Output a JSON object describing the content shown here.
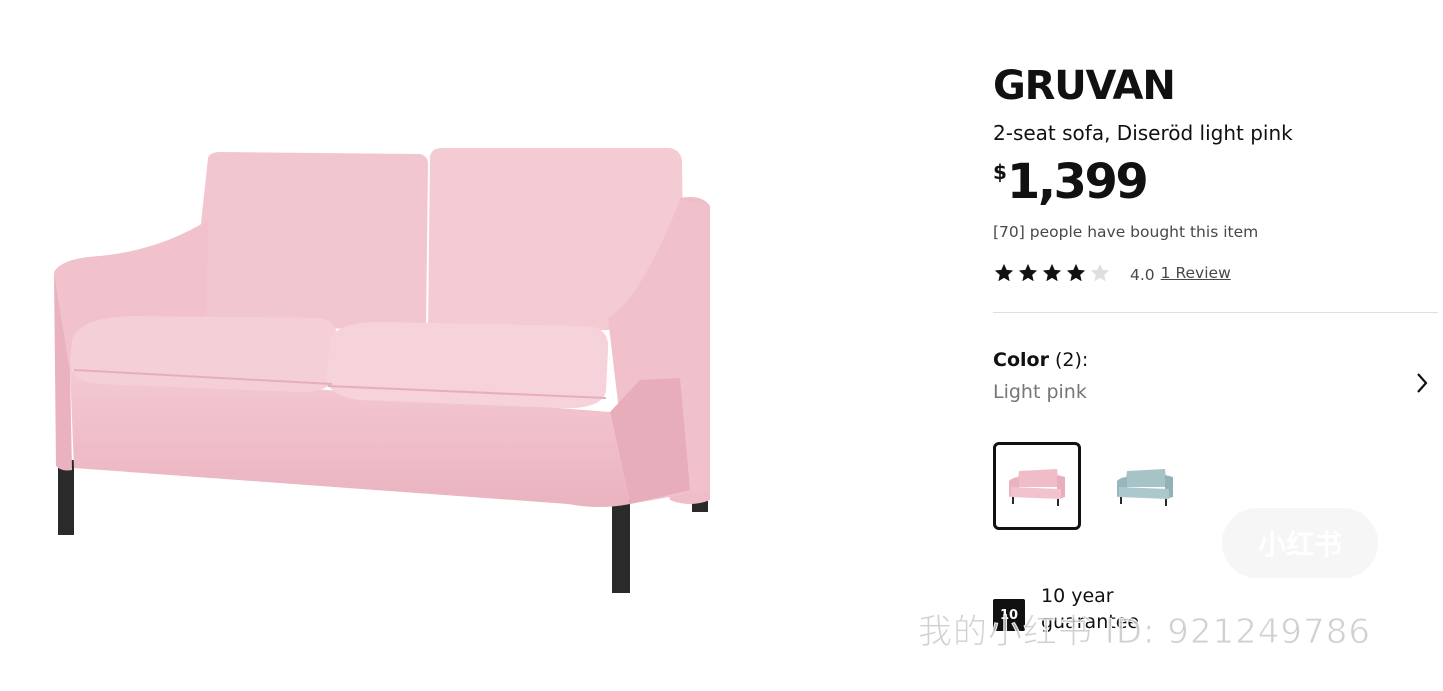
{
  "product": {
    "name": "GRUVAN",
    "description": "2-seat sofa, Diseröd light pink",
    "currency": "$",
    "price": "1,399",
    "bought_text": "[70] people have bought this item",
    "image_icon": "pink-sofa-image"
  },
  "rating": {
    "value": "4.0",
    "stars_filled": 4,
    "stars_total": 5,
    "review_link": "1 Review"
  },
  "color": {
    "label": "Color",
    "count": " (2):",
    "selected": "Light pink",
    "options": [
      {
        "name": "light-pink",
        "color": "#f0bcc8"
      },
      {
        "name": "light-blue",
        "color": "#a6c3c8"
      }
    ]
  },
  "guarantee": {
    "badge": "10",
    "text": "10 year guarantee"
  },
  "watermark": {
    "text": "我的小红书 ID: 921249786",
    "logo": "小红书"
  },
  "colors": {
    "text": "#111111",
    "muted": "#767676",
    "sofa_pink": "#f2c3cd",
    "legs": "#2a2a2a"
  }
}
